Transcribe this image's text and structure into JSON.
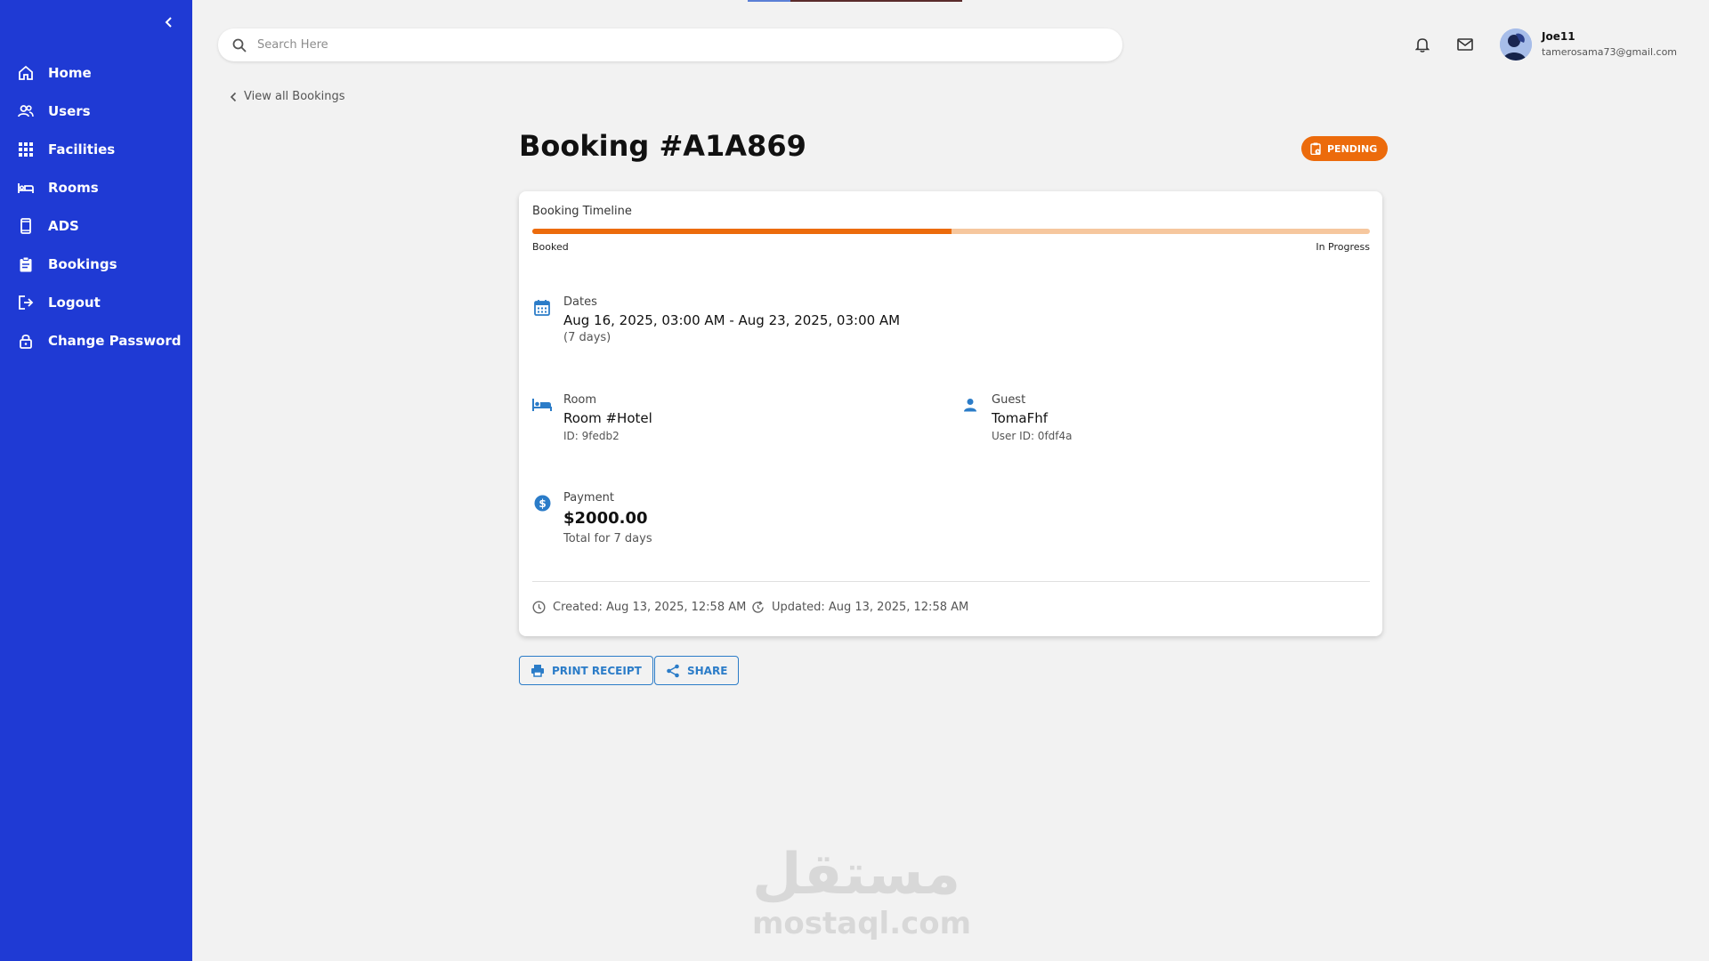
{
  "sidebar": {
    "items": [
      {
        "label": "Home",
        "icon": "home-icon"
      },
      {
        "label": "Users",
        "icon": "users-icon"
      },
      {
        "label": "Facilities",
        "icon": "grid-icon"
      },
      {
        "label": "Rooms",
        "icon": "bed-icon"
      },
      {
        "label": "ADS",
        "icon": "phone-icon"
      },
      {
        "label": "Bookings",
        "icon": "clipboard-icon"
      },
      {
        "label": "Logout",
        "icon": "logout-icon"
      },
      {
        "label": "Change Password",
        "icon": "lock-icon"
      }
    ]
  },
  "header": {
    "search_placeholder": "Search Here",
    "user": {
      "name": "Joe11",
      "email": "tamerosama73@gmail.com"
    }
  },
  "back_link": "View all Bookings",
  "booking": {
    "title": "Booking #A1A869",
    "status": "PENDING",
    "timeline": {
      "title": "Booking Timeline",
      "start_label": "Booked",
      "end_label": "In Progress",
      "progress": 0.5
    },
    "dates": {
      "label": "Dates",
      "value": "Aug 16, 2025, 03:00 AM - Aug 23, 2025, 03:00 AM",
      "sub": "(7 days)"
    },
    "room": {
      "label": "Room",
      "value": "Room #Hotel",
      "sub": "ID: 9fedb2"
    },
    "guest": {
      "label": "Guest",
      "value": "TomaFhf",
      "sub": "User ID: 0fdf4a"
    },
    "payment": {
      "label": "Payment",
      "value": "$2000.00",
      "sub": "Total for 7 days"
    },
    "created": "Created: Aug 13, 2025, 12:58 AM",
    "updated": "Updated: Aug 13, 2025, 12:58 AM"
  },
  "actions": {
    "print": "PRINT RECEIPT",
    "share": "SHARE"
  },
  "watermark": {
    "arabic": "مستقل",
    "latin": "mostaql.com"
  },
  "colors": {
    "sidebar": "#1f3ad4",
    "accent": "#ec6b0c",
    "accent_light": "#f6c79e",
    "link": "#2b7cc8",
    "background": "#f2f2f2"
  }
}
